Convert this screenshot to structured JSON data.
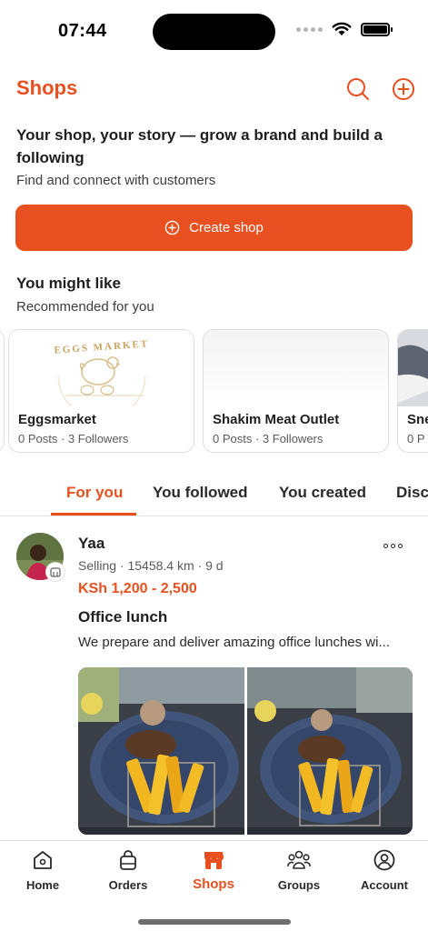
{
  "status_bar": {
    "time": "07:44"
  },
  "header": {
    "title": "Shops"
  },
  "intro": {
    "title": "Your shop, your story — grow a brand and build a following",
    "subtitle": "Find and connect with customers",
    "create_button": "Create shop"
  },
  "recommendations": {
    "title": "You might like",
    "subtitle": "Recommended for you",
    "shops": [
      {
        "name": "Eggsmarket",
        "meta": "0 Posts · 3 Followers",
        "logo_text": "EGGS MARKET"
      },
      {
        "name": "Shakim Meat Outlet",
        "meta": "0 Posts · 3 Followers"
      },
      {
        "name": "Sne",
        "meta": "0 P"
      }
    ]
  },
  "tabs": [
    "For you",
    "You followed",
    "You created",
    "Disc"
  ],
  "post": {
    "author": "Yaa",
    "meta": "Selling · 15458.4 km · 9 d",
    "price": "KSh 1,200 - 2,500",
    "title": "Office lunch",
    "description": "We prepare and deliver amazing office lunches wi..."
  },
  "bottom_nav": [
    {
      "label": "Home",
      "icon": "home-icon"
    },
    {
      "label": "Orders",
      "icon": "bag-icon"
    },
    {
      "label": "Shops",
      "icon": "shop-icon"
    },
    {
      "label": "Groups",
      "icon": "groups-icon"
    },
    {
      "label": "Account",
      "icon": "account-icon"
    }
  ],
  "colors": {
    "accent": "#e8501f"
  }
}
